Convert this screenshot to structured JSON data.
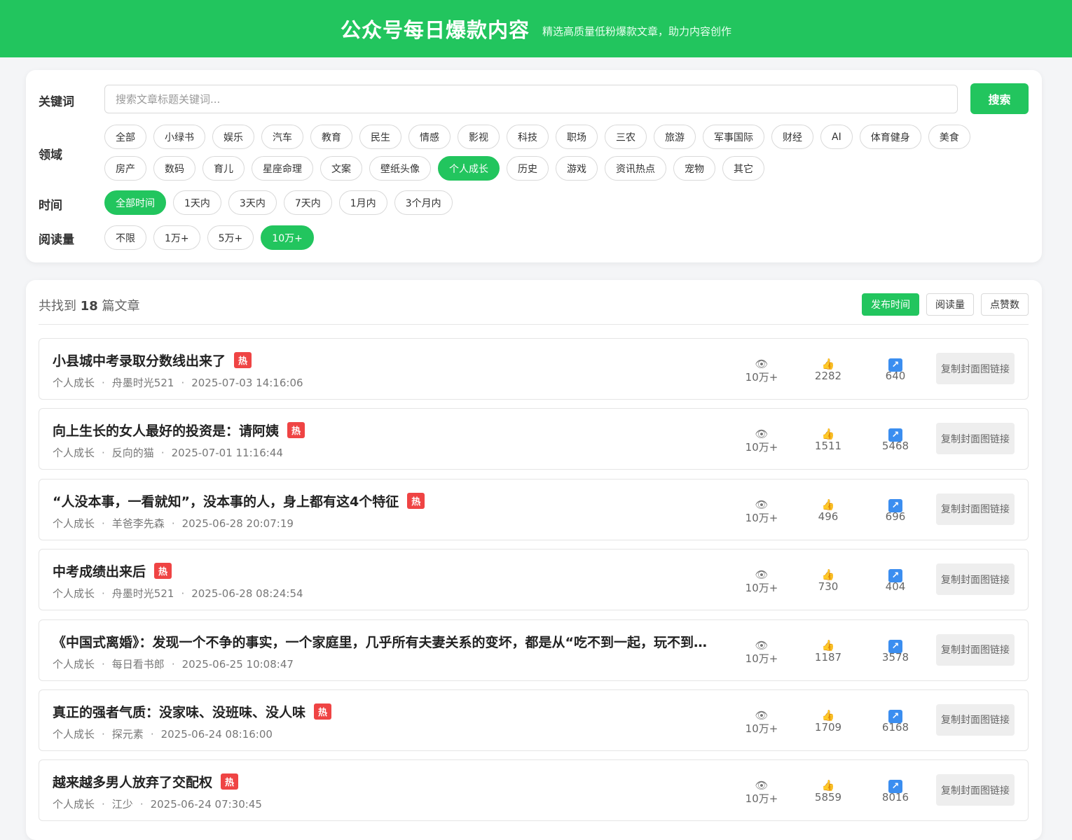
{
  "header": {
    "title": "公众号每日爆款内容",
    "subtitle": "精选高质量低粉爆款文章，助力内容创作"
  },
  "filters": {
    "keyword_label": "关键词",
    "search_placeholder": "搜索文章标题关键词...",
    "search_button": "搜索",
    "domain_label": "领域",
    "domains": [
      {
        "label": "全部",
        "active": false
      },
      {
        "label": "小绿书",
        "active": false
      },
      {
        "label": "娱乐",
        "active": false
      },
      {
        "label": "汽车",
        "active": false
      },
      {
        "label": "教育",
        "active": false
      },
      {
        "label": "民生",
        "active": false
      },
      {
        "label": "情感",
        "active": false
      },
      {
        "label": "影视",
        "active": false
      },
      {
        "label": "科技",
        "active": false
      },
      {
        "label": "职场",
        "active": false
      },
      {
        "label": "三农",
        "active": false
      },
      {
        "label": "旅游",
        "active": false
      },
      {
        "label": "军事国际",
        "active": false
      },
      {
        "label": "财经",
        "active": false
      },
      {
        "label": "AI",
        "active": false
      },
      {
        "label": "体育健身",
        "active": false
      },
      {
        "label": "美食",
        "active": false
      },
      {
        "label": "房产",
        "active": false
      },
      {
        "label": "数码",
        "active": false
      },
      {
        "label": "育儿",
        "active": false
      },
      {
        "label": "星座命理",
        "active": false
      },
      {
        "label": "文案",
        "active": false
      },
      {
        "label": "壁纸头像",
        "active": false
      },
      {
        "label": "个人成长",
        "active": true
      },
      {
        "label": "历史",
        "active": false
      },
      {
        "label": "游戏",
        "active": false
      },
      {
        "label": "资讯热点",
        "active": false
      },
      {
        "label": "宠物",
        "active": false
      },
      {
        "label": "其它",
        "active": false
      }
    ],
    "time_label": "时间",
    "times": [
      {
        "label": "全部时间",
        "active": true
      },
      {
        "label": "1天内",
        "active": false
      },
      {
        "label": "3天内",
        "active": false
      },
      {
        "label": "7天内",
        "active": false
      },
      {
        "label": "1月内",
        "active": false
      },
      {
        "label": "3个月内",
        "active": false
      }
    ],
    "reads_label": "阅读量",
    "reads": [
      {
        "label": "不限",
        "active": false
      },
      {
        "label": "1万+",
        "active": false
      },
      {
        "label": "5万+",
        "active": false
      },
      {
        "label": "10万+",
        "active": true
      }
    ]
  },
  "results": {
    "count_prefix": "共找到",
    "count": "18",
    "count_suffix": "篇文章",
    "sort_buttons": [
      {
        "label": "发布时间",
        "active": true
      },
      {
        "label": "阅读量",
        "active": false
      },
      {
        "label": "点赞数",
        "active": false
      }
    ],
    "copy_button_label": "复制封面图链接",
    "hot_label": "热",
    "meta_separator": "·",
    "articles": [
      {
        "title": "小县城中考录取分数线出来了",
        "hot": true,
        "category": "个人成长",
        "author": "舟墨时光521",
        "date": "2025-07-03 14:16:06",
        "views": "10万+",
        "likes": "2282",
        "shares": "640"
      },
      {
        "title": "向上生长的女人最好的投资是：请阿姨",
        "hot": true,
        "category": "个人成长",
        "author": "反向的猫",
        "date": "2025-07-01 11:16:44",
        "views": "10万+",
        "likes": "1511",
        "shares": "5468"
      },
      {
        "title": "“人没本事，一看就知”，没本事的人，身上都有这4个特征",
        "hot": true,
        "category": "个人成长",
        "author": "羊爸李先森",
        "date": "2025-06-28 20:07:19",
        "views": "10万+",
        "likes": "496",
        "shares": "696"
      },
      {
        "title": "中考成绩出来后",
        "hot": true,
        "category": "个人成长",
        "author": "舟墨时光521",
        "date": "2025-06-28 08:24:54",
        "views": "10万+",
        "likes": "730",
        "shares": "404"
      },
      {
        "title": "《中国式离婚》：发现一个不争的事实，一个家庭里，几乎所有夫妻关系的变坏，都是从“吃不到一起，玩不到一起”开始的",
        "hot": false,
        "category": "个人成长",
        "author": "每日看书郎",
        "date": "2025-06-25 10:08:47",
        "views": "10万+",
        "likes": "1187",
        "shares": "3578"
      },
      {
        "title": "真正的强者气质：没家味、没班味、没人味",
        "hot": true,
        "category": "个人成长",
        "author": "探元素",
        "date": "2025-06-24 08:16:00",
        "views": "10万+",
        "likes": "1709",
        "shares": "6168"
      },
      {
        "title": "越来越多男人放弃了交配权",
        "hot": true,
        "category": "个人成长",
        "author": "江少",
        "date": "2025-06-24 07:30:45",
        "views": "10万+",
        "likes": "5859",
        "shares": "8016"
      }
    ]
  }
}
